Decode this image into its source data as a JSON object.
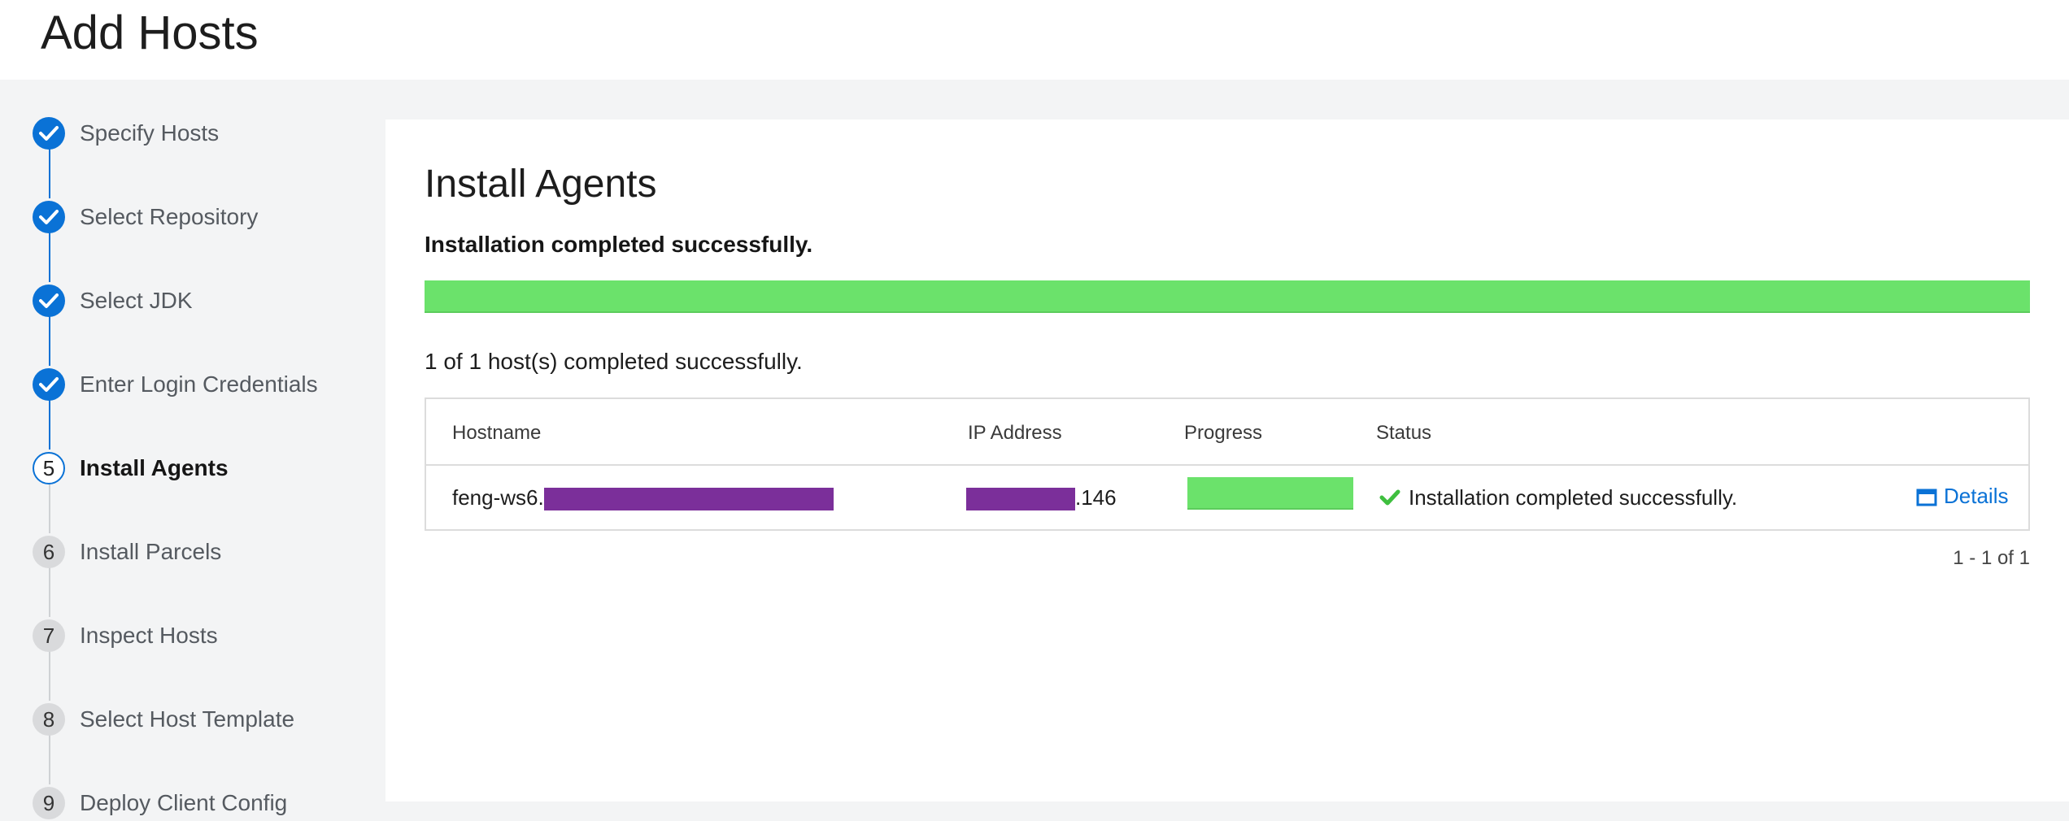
{
  "header": {
    "title": "Add Hosts"
  },
  "wizard": {
    "steps": [
      {
        "number": "1",
        "label": "Specify Hosts",
        "state": "done"
      },
      {
        "number": "2",
        "label": "Select Repository",
        "state": "done"
      },
      {
        "number": "3",
        "label": "Select JDK",
        "state": "done"
      },
      {
        "number": "4",
        "label": "Enter Login Credentials",
        "state": "done"
      },
      {
        "number": "5",
        "label": "Install Agents",
        "state": "active"
      },
      {
        "number": "6",
        "label": "Install Parcels",
        "state": "todo"
      },
      {
        "number": "7",
        "label": "Inspect Hosts",
        "state": "todo"
      },
      {
        "number": "8",
        "label": "Select Host Template",
        "state": "todo"
      },
      {
        "number": "9",
        "label": "Deploy Client Config",
        "state": "todo"
      }
    ]
  },
  "main": {
    "title": "Install Agents",
    "status_heading": "Installation completed successfully.",
    "overall_progress": 1.0,
    "summary": "1 of 1 host(s) completed successfully.",
    "table": {
      "headers": {
        "hostname": "Hostname",
        "ip": "IP Address",
        "progress": "Progress",
        "status": "Status"
      },
      "rows": [
        {
          "hostname_prefix": "feng-ws6.",
          "ip_suffix": ".146",
          "progress": 1.0,
          "status": "Installation completed successfully.",
          "details_label": "Details"
        }
      ]
    },
    "pagination": "1 - 1 of 1"
  },
  "colors": {
    "accent": "#0a72d6",
    "success": "#6be26b",
    "redaction": "#7b2f9a"
  },
  "icons": {
    "done_step": "check-icon",
    "status": "check-icon",
    "details": "window-icon"
  }
}
